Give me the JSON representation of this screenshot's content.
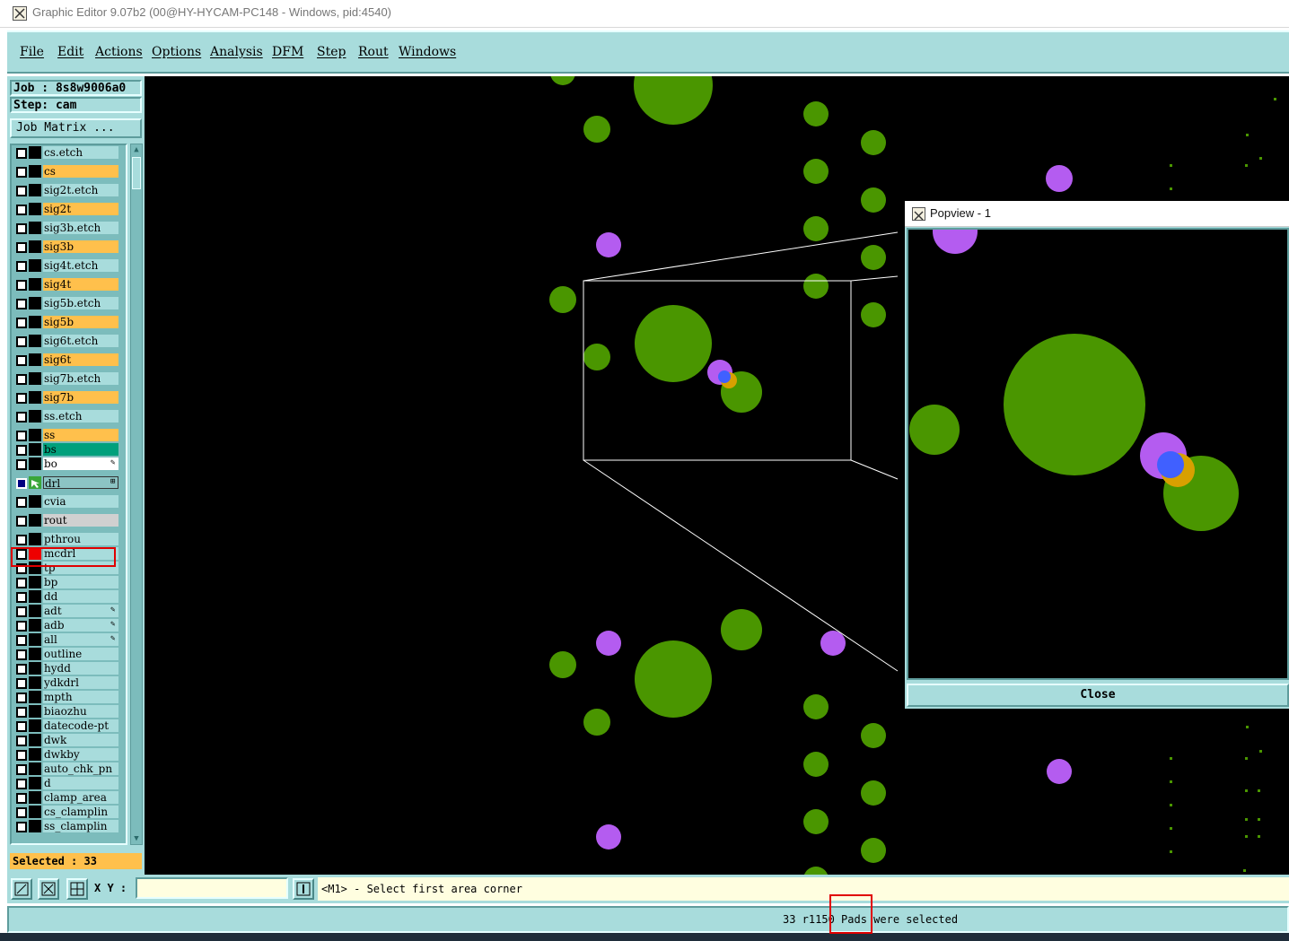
{
  "window": {
    "title": "Graphic Editor 9.07b2 (00@HY-HYCAM-PC148 - Windows, pid:4540)"
  },
  "menu": [
    "File",
    "Edit",
    "Actions",
    "Options",
    "Analysis",
    "DFM",
    "Step",
    "Rout",
    "Windows"
  ],
  "panel": {
    "job": "Job : 8s8w9006a0",
    "step": "Step: cam",
    "job_matrix": "Job Matrix ...",
    "selected": "Selected : 33"
  },
  "layers": [
    {
      "name": "cs.etch",
      "color": "teal"
    },
    {
      "name": "cs",
      "color": "orange"
    },
    {
      "name": "sig2t.etch",
      "color": "teal"
    },
    {
      "name": "sig2t",
      "color": "orange"
    },
    {
      "name": "sig3b.etch",
      "color": "teal"
    },
    {
      "name": "sig3b",
      "color": "orange"
    },
    {
      "name": "sig4t.etch",
      "color": "teal"
    },
    {
      "name": "sig4t",
      "color": "orange"
    },
    {
      "name": "sig5b.etch",
      "color": "teal"
    },
    {
      "name": "sig5b",
      "color": "orange"
    },
    {
      "name": "sig6t.etch",
      "color": "teal"
    },
    {
      "name": "sig6t",
      "color": "orange"
    },
    {
      "name": "sig7b.etch",
      "color": "teal"
    },
    {
      "name": "sig7b",
      "color": "orange"
    },
    {
      "name": "ss.etch",
      "color": "teal"
    },
    {
      "name": "ss",
      "color": "orange"
    },
    {
      "name": "bs",
      "color": "green"
    },
    {
      "name": "bo",
      "color": "white",
      "flag": "pen"
    },
    {
      "name": "drl",
      "color": "active",
      "flag": "grid"
    },
    {
      "name": "cvia",
      "color": "teal"
    },
    {
      "name": "rout",
      "color": "gray"
    },
    {
      "name": "pthrou",
      "color": "teal"
    },
    {
      "name": "mcdrl",
      "color": "teal",
      "indicator": "red"
    },
    {
      "name": "tp",
      "color": "teal"
    },
    {
      "name": "bp",
      "color": "teal"
    },
    {
      "name": "dd",
      "color": "teal"
    },
    {
      "name": "adt",
      "color": "teal",
      "flag": "pen"
    },
    {
      "name": "adb",
      "color": "teal",
      "flag": "pen"
    },
    {
      "name": "all",
      "color": "teal",
      "flag": "pen"
    },
    {
      "name": "outline",
      "color": "teal"
    },
    {
      "name": "hydd",
      "color": "teal"
    },
    {
      "name": "ydkdrl",
      "color": "teal"
    },
    {
      "name": "mpth",
      "color": "teal"
    },
    {
      "name": "biaozhu",
      "color": "teal"
    },
    {
      "name": "datecode-pt",
      "color": "teal"
    },
    {
      "name": "dwk",
      "color": "teal"
    },
    {
      "name": "dwkby",
      "color": "teal"
    },
    {
      "name": "auto_chk_pn",
      "color": "teal"
    },
    {
      "name": "d",
      "color": "teal"
    },
    {
      "name": "clamp_area",
      "color": "teal"
    },
    {
      "name": "cs_clamplin",
      "color": "teal"
    },
    {
      "name": "ss_clamplin",
      "color": "teal"
    }
  ],
  "popview": {
    "title": "Popview - 1",
    "close_label": "Close"
  },
  "command": {
    "xy_label": "X Y :",
    "xy_value": "",
    "prompt": "<M1> - Select first area corner"
  },
  "status": {
    "message": "33 r1150 Pads were selected"
  },
  "colors": {
    "accent_teal": "#a8dcdc",
    "layer_orange": "#ffc04c",
    "pad_green": "#4a9600",
    "pad_purple": "#b45cf0",
    "pad_blue": "#4060ff",
    "pad_orange": "#d8a000",
    "highlight_red": "#e00000"
  },
  "icons": [
    "graphic-editor-icon",
    "zoom-area-icon",
    "zoom-fit-icon",
    "grid-snap-icon",
    "measure-icon"
  ]
}
